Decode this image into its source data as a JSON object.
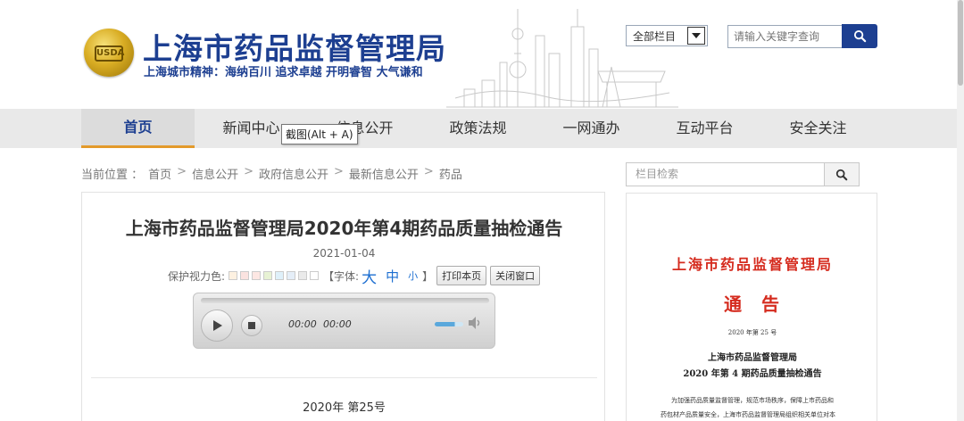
{
  "header": {
    "emblem_text": "USDA",
    "title": "上海市药品监督管理局",
    "slogan": "上海城市精神：海纳百川  追求卓越  开明睿智  大气谦和",
    "search_scope": "全部栏目",
    "search_placeholder": "请输入关键字查询"
  },
  "nav": {
    "items": [
      {
        "label": "首页",
        "active": true
      },
      {
        "label": "新闻中心"
      },
      {
        "label": "信息公开"
      },
      {
        "label": "政策法规"
      },
      {
        "label": "一网通办"
      },
      {
        "label": "互动平台"
      },
      {
        "label": "安全关注"
      }
    ]
  },
  "breadcrumb": {
    "prefix": "当前位置 ：",
    "items": [
      "首页",
      "信息公开",
      "政府信息公开",
      "最新信息公开",
      "药品"
    ],
    "separator": ">"
  },
  "article": {
    "title": "上海市药品监督管理局2020年第4期药品质量抽检通告",
    "date": "2021-01-04",
    "eye_care_label": "保护视力色:",
    "eye_care_colors": [
      "#fdf1e1",
      "#fbe3e0",
      "#fde7e3",
      "#e7f2d4",
      "#dff0fa",
      "#e5eef8",
      "#eaeaea",
      "#ffffff"
    ],
    "font_label_open": "【字体:",
    "font_big": "大",
    "font_mid": "中",
    "font_small": "小",
    "font_label_close": "】",
    "print_button": "打印本页",
    "close_button": "关闭窗口",
    "doc_number": "2020年   第25号"
  },
  "player": {
    "current_time": "00:00",
    "duration": "00:00",
    "volume": 0.7
  },
  "tooltip": "截图(Alt + A)",
  "sidebar": {
    "search_placeholder": "栏目检索",
    "doc": {
      "issuer": "上海市药品监督管理局",
      "notice": "通告",
      "date": "2020 年第 25 号",
      "title_line1": "上海市药品监督管理局",
      "title_line2": "2020 年第 4 期药品质量抽检通告",
      "body_line1": "为加强药品质量监督管理，规范市场秩序，保障上市药品和",
      "body_line2": "药包材产品质量安全，上海市药品监督管理局组织相关单位对本"
    }
  },
  "colors": {
    "brand": "#1d3f91",
    "nav_active_underline": "#e39a2b",
    "doc_red": "#d52b1e"
  }
}
